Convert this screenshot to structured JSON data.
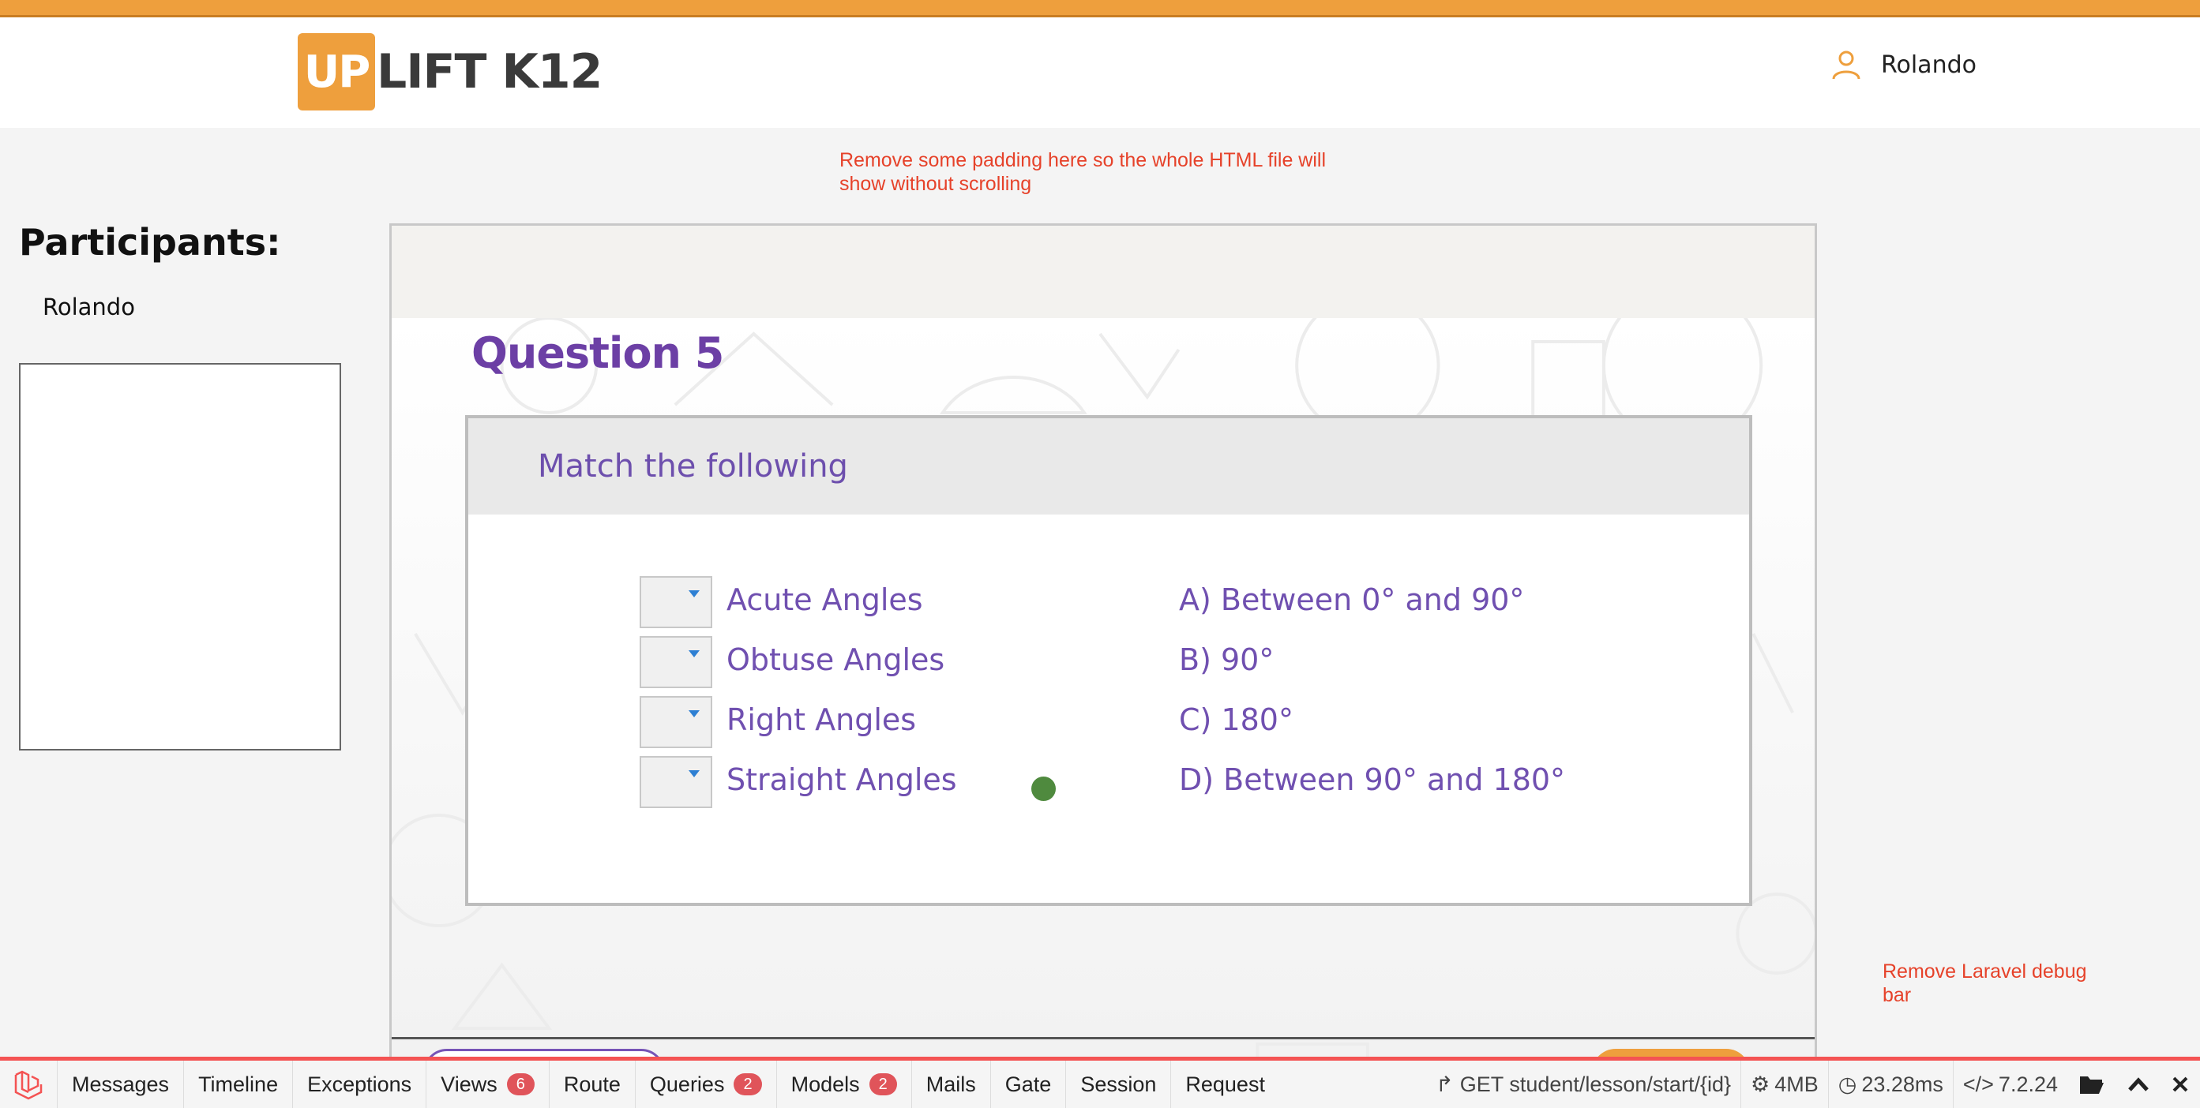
{
  "header": {
    "logo_mark": "UP",
    "logo_text": "LIFT K12",
    "user_name": "Rolando"
  },
  "annotations": {
    "top": "Remove some padding here so the whole HTML file will show without scrolling",
    "bottom": "Remove Laravel debug bar"
  },
  "sidebar": {
    "title": "Participants:",
    "participants": [
      "Rolando"
    ]
  },
  "question": {
    "title": "Question 5",
    "prompt": "Match the following",
    "left_items": [
      "Acute Angles",
      "Obtuse Angles",
      "Right Angles",
      "Straight Angles"
    ],
    "right_items": [
      "A) Between 0° and 90°",
      "B) 90°",
      "C) 180°",
      "D) Between 90° and 180°"
    ]
  },
  "debugbar": {
    "tabs": [
      {
        "label": "Messages"
      },
      {
        "label": "Timeline"
      },
      {
        "label": "Exceptions"
      },
      {
        "label": "Views",
        "badge": "6"
      },
      {
        "label": "Route"
      },
      {
        "label": "Queries",
        "badge": "2"
      },
      {
        "label": "Models",
        "badge": "2"
      },
      {
        "label": "Mails"
      },
      {
        "label": "Gate"
      },
      {
        "label": "Session"
      },
      {
        "label": "Request"
      }
    ],
    "route": "GET student/lesson/start/{id}",
    "memory": "4MB",
    "time": "23.28ms",
    "version": "7.2.24"
  },
  "colors": {
    "brand_orange": "#ee9f3d",
    "question_purple": "#6c3fa5",
    "annotation_red": "#e6422a",
    "debug_red": "#f45353"
  }
}
